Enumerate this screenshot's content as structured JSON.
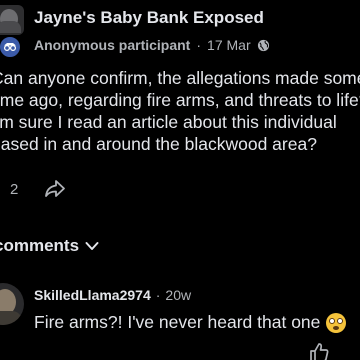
{
  "post": {
    "group_name": "Jayne's Baby Bank Exposed",
    "author": "Anonymous participant",
    "separator": "·",
    "date": "17 Mar",
    "privacy_icon": "globe-icon",
    "body_lines": [
      "Can anyone confirm, the allegations made some",
      "time ago, regarding fire arms, and threats to life?",
      "I'm sure I read an article about this individual",
      "based in and around the blackwood area?"
    ],
    "reaction_count": "2",
    "share_icon": "share-icon"
  },
  "comments_section": {
    "header": "comments",
    "sort_icon": "chevron-down-icon"
  },
  "comment": {
    "author": "SkilledLlama2974",
    "separator": "·",
    "age": "20w",
    "text": "Fire arms?! I've never heard that one",
    "emoji_icon": "flushed-face-icon",
    "like_icon": "thumbs-up-icon"
  },
  "colors": {
    "background": "#000000",
    "primary_text": "#e4e6eb",
    "secondary_text": "#b0b3b8",
    "anonymous_badge": "#3b5aa8",
    "emoji": "#f5c33b"
  }
}
